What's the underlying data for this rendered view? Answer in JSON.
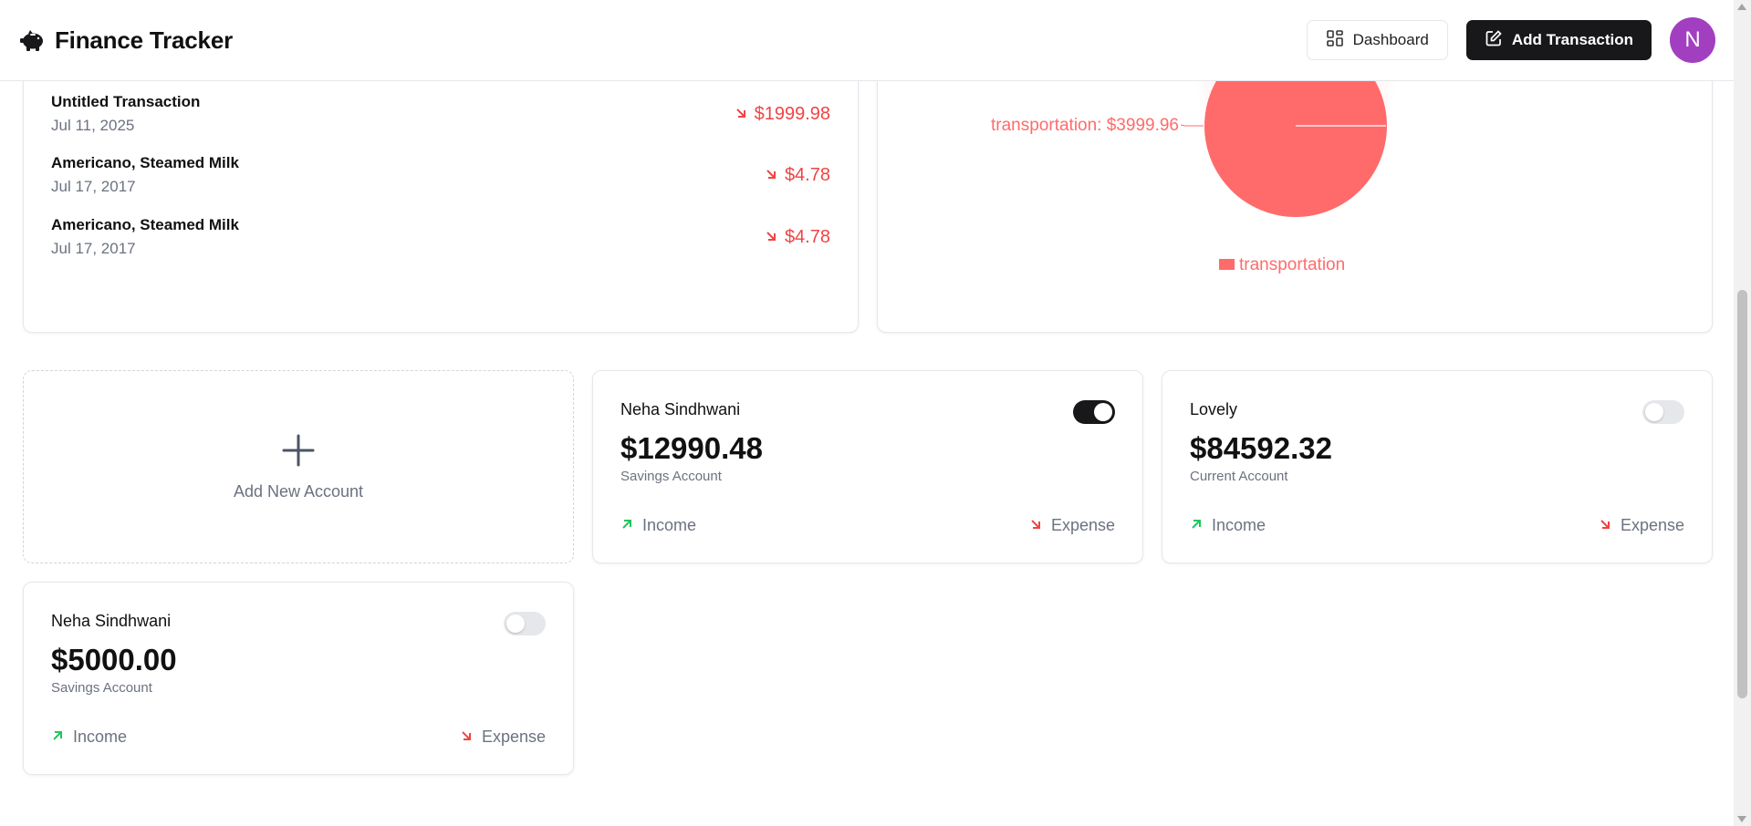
{
  "header": {
    "title": "Finance Tracker",
    "brand_icon": "piggy-bank-icon",
    "dashboard_label": "Dashboard",
    "add_transaction_label": "Add Transaction",
    "avatar_initial": "N"
  },
  "transactions": [
    {
      "name": "Untitled Transaction",
      "date": "Jul 11, 2025",
      "amount": "$1999.98",
      "direction": "expense"
    },
    {
      "name": "Americano, Steamed Milk",
      "date": "Jul 17, 2017",
      "amount": "$4.78",
      "direction": "expense"
    },
    {
      "name": "Americano, Steamed Milk",
      "date": "Jul 17, 2017",
      "amount": "$4.78",
      "direction": "expense"
    }
  ],
  "chart_data": {
    "type": "pie",
    "title": "",
    "slices": [
      {
        "label": "transportation",
        "value": 3999.96,
        "color": "#ff6b6b"
      }
    ],
    "slice_label": "transportation: $3999.96",
    "legend": [
      {
        "label": "transportation",
        "color": "#ff6b6b"
      }
    ],
    "legend_position": "bottom"
  },
  "add_account": {
    "label": "Add New Account"
  },
  "accounts": [
    {
      "owner": "Neha Sindhwani",
      "balance": "$12990.48",
      "type": "Savings Account",
      "default": true
    },
    {
      "owner": "Lovely",
      "balance": "$84592.32",
      "type": "Current Account",
      "default": false
    },
    {
      "owner": "Neha Sindhwani",
      "balance": "$5000.00",
      "type": "Savings Account",
      "default": false
    }
  ],
  "account_actions": {
    "income_label": "Income",
    "expense_label": "Expense"
  },
  "colors": {
    "expense": "#ef4444",
    "income": "#22c55e",
    "pie": "#ff6b6b",
    "avatar": "#a23fc0",
    "primary_button": "#18181b"
  }
}
